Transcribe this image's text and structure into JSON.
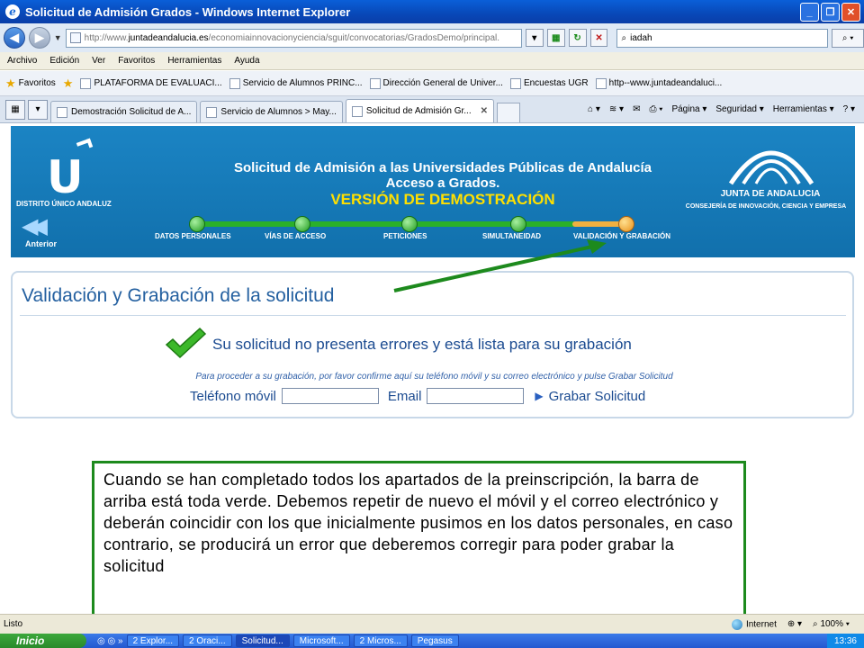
{
  "window": {
    "title": "Solicitud de Admisión Grados - Windows Internet Explorer",
    "buttons": {
      "minimize": "_",
      "maximize": "❐",
      "close": "✕"
    }
  },
  "address_bar": {
    "url_prefix": "http://www.",
    "url_domain": "juntadeandalucia.es",
    "url_rest": "/economiainnovacionyciencia/sguit/convocatorias/GradosDemo/principal.",
    "search_value": "iadah"
  },
  "menu": [
    "Archivo",
    "Edición",
    "Ver",
    "Favoritos",
    "Herramientas",
    "Ayuda"
  ],
  "favorites": {
    "label": "Favoritos",
    "items": [
      "PLATAFORMA DE EVALUACI...",
      "Servicio de Alumnos PRINC...",
      "Dirección General de Univer...",
      "Encuestas UGR",
      "http--www.juntadeandaluci..."
    ]
  },
  "tabs": [
    {
      "label": "Demostración Solicitud de A..."
    },
    {
      "label": "Servicio de Alumnos > May..."
    },
    {
      "label": "Solicitud de Admisión Gr...",
      "active": true
    }
  ],
  "command_bar": {
    "page": "Página",
    "security": "Seguridad",
    "tools": "Herramientas"
  },
  "banner": {
    "logo": "U",
    "distrito": "DISTRITO ÚNICO ANDALUZ",
    "back_label": "Anterior",
    "title_line1": "Solicitud de Admisión a las Universidades Públicas de Andalucía",
    "title_line2": "Acceso a Grados.",
    "title_line3": "VERSIÓN DE DEMOSTRACIÓN",
    "junta": "JUNTA DE ANDALUCIA",
    "consejeria": "CONSEJERÍA DE INNOVACIÓN, CIENCIA Y EMPRESA",
    "steps": [
      "DATOS PERSONALES",
      "VÍAS DE ACCESO",
      "PETICIONES",
      "SIMULTANEIDAD",
      "VALIDACIÓN Y GRABACIÓN"
    ]
  },
  "panel": {
    "title": "Validación y Grabación de la solicitud",
    "ok_message": "Su solicitud no presenta errores y está lista para su grabación",
    "hint": "Para proceder a su grabación, por favor confirme aquí su teléfono móvil y su correo electrónico y pulse Grabar Solicitud",
    "phone_label": "Teléfono móvil",
    "phone_value": "",
    "email_label": "Email",
    "email_value": "",
    "save_label": "Grabar Solicitud"
  },
  "callout": {
    "text": "Cuando se han completado todos los apartados de la preinscripción, la barra de arriba está toda verde. Debemos repetir de nuevo el móvil y el correo electrónico y deberán coincidir con los que inicialmente pusimos en los datos personales, en caso contrario, se producirá un error que deberemos corregir para poder grabar la solicitud"
  },
  "status_bar": {
    "status": "Listo",
    "zone": "Internet",
    "zoom": "100%"
  },
  "taskbar": {
    "start": "Inicio",
    "items": [
      "2 Explor...",
      "2 Oraci...",
      "Solicitud...",
      "Microsoft...",
      "2 Micros...",
      "Pegasus"
    ],
    "clock": "13:36"
  },
  "colors": {
    "accent_green": "#1d8a1d",
    "banner_blue": "#1b84c4",
    "title_blue": "#2460a0"
  }
}
